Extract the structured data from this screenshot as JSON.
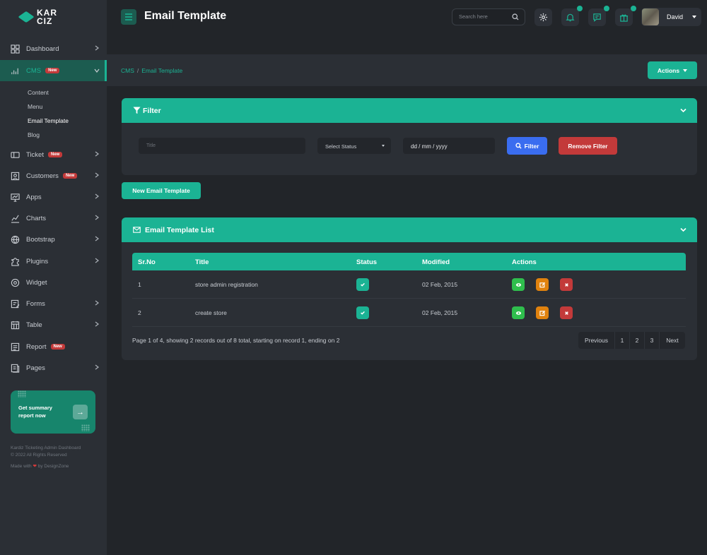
{
  "brand": {
    "line1": "KAR",
    "line2": "CIZ"
  },
  "header": {
    "title": "Email Template",
    "search_placeholder": "Search here",
    "user_name": "David"
  },
  "sidebar": {
    "items": [
      {
        "label": "Dashboard",
        "icon": "dashboard-icon",
        "badge": ""
      },
      {
        "label": "CMS",
        "icon": "chart-bars-icon",
        "badge": "New"
      },
      {
        "label": "Ticket",
        "icon": "ticket-icon",
        "badge": "New"
      },
      {
        "label": "Customers",
        "icon": "customers-icon",
        "badge": "New"
      },
      {
        "label": "Apps",
        "icon": "apps-icon",
        "badge": ""
      },
      {
        "label": "Charts",
        "icon": "charts-icon",
        "badge": ""
      },
      {
        "label": "Bootstrap",
        "icon": "globe-icon",
        "badge": ""
      },
      {
        "label": "Plugins",
        "icon": "puzzle-icon",
        "badge": ""
      },
      {
        "label": "Widget",
        "icon": "widget-icon",
        "badge": ""
      },
      {
        "label": "Forms",
        "icon": "forms-icon",
        "badge": ""
      },
      {
        "label": "Table",
        "icon": "table-icon",
        "badge": ""
      },
      {
        "label": "Report",
        "icon": "report-icon",
        "badge": "New"
      },
      {
        "label": "Pages",
        "icon": "pages-icon",
        "badge": ""
      }
    ],
    "cms_sub": [
      "Content",
      "Menu",
      "Email Template",
      "Blog"
    ],
    "promo": {
      "text": "Get summary report now"
    },
    "footer": {
      "line1": "Kardiz Ticketing Admin Dashboard",
      "line2": "© 2022 All Rights Reserved",
      "made_prefix": "Made with",
      "made_suffix": "by DesignZone"
    }
  },
  "breadcrumb": {
    "root": "CMS",
    "sep": "/",
    "current": "Email Template"
  },
  "actions_label": "Actions",
  "filter": {
    "title": "Filter",
    "title_placeholder": "Title",
    "status_placeholder": "Select Status",
    "date_placeholder": "dd / mm / yyyy",
    "filter_label": "Filter",
    "remove_label": "Remove Filter"
  },
  "new_button": "New Email Template",
  "list": {
    "title": "Email Template List",
    "columns": [
      "Sr.No",
      "Title",
      "Status",
      "Modified",
      "Actions"
    ],
    "rows": [
      {
        "srno": "1",
        "title": "store admin registration",
        "modified": "02 Feb, 2015"
      },
      {
        "srno": "2",
        "title": "create store",
        "modified": "02 Feb, 2015"
      }
    ],
    "pager_info": "Page 1 of 4, showing 2 records out of 8 total, starting on record 1, ending on 2",
    "pages": [
      "Previous",
      "1",
      "2",
      "3",
      "Next"
    ]
  },
  "colors": {
    "accent": "#1bb394",
    "danger": "#c33a3a",
    "primary": "#3a6df0",
    "success": "#2fbe4d",
    "warning": "#e0820e"
  }
}
